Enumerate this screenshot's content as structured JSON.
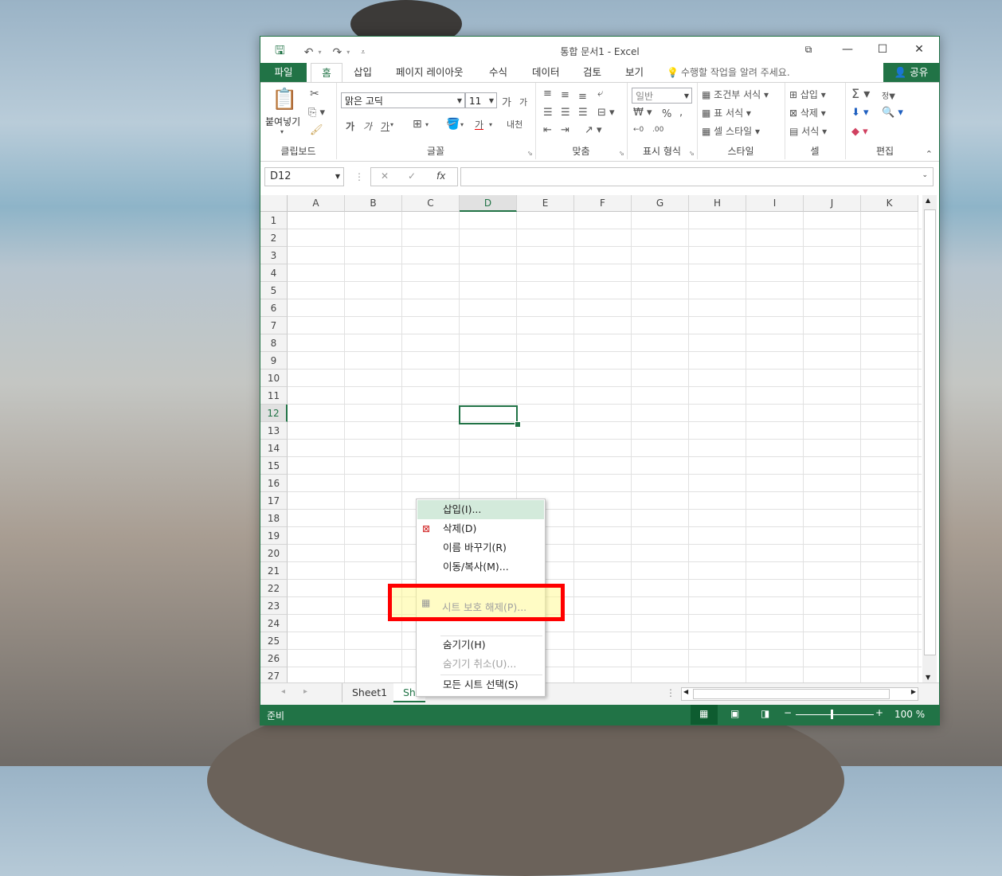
{
  "window": {
    "title": "통합 문서1 - Excel"
  },
  "tabs": {
    "file": "파일",
    "home": "홈",
    "insert": "삽입",
    "layout": "페이지 레이아웃",
    "formulas": "수식",
    "data": "데이터",
    "review": "검토",
    "view": "보기",
    "tell_me": "수행할 작업을 알려 주세요.",
    "share": "공유"
  },
  "ribbon": {
    "paste": "붙여넣기",
    "clipboard": "클립보드",
    "font_name": "맑은 고딕",
    "font_size": "11",
    "font": "글꼴",
    "align": "맞춤",
    "number_format": "일반",
    "number": "표시 형식",
    "cond_format": "조건부 서식",
    "table_format": "표 서식",
    "cell_style": "셀 스타일",
    "styles": "스타일",
    "insert": "삽입",
    "delete": "삭제",
    "format": "서식",
    "cells": "셀",
    "editing": "편집",
    "bold": "가",
    "italic": "가",
    "underline": "가",
    "grow_font": "가",
    "shrink_font": "가",
    "font_color": "가",
    "phonetic": "내천",
    "percent": "%",
    "comma": ",",
    "dec_inc": "←0",
    "dec_dec": ".00",
    "sort_filter": "정▼"
  },
  "formula": {
    "namebox": "D12",
    "cancel": "✕",
    "enter": "✓",
    "fx": "fx",
    "value": ""
  },
  "grid": {
    "columns": [
      "A",
      "B",
      "C",
      "D",
      "E",
      "F",
      "G",
      "H",
      "I",
      "J",
      "K"
    ],
    "rows": [
      "1",
      "2",
      "3",
      "4",
      "5",
      "6",
      "7",
      "8",
      "9",
      "10",
      "11",
      "12",
      "13",
      "14",
      "15",
      "16",
      "17",
      "18",
      "19",
      "20",
      "21",
      "22",
      "23",
      "24",
      "25",
      "26",
      "27"
    ],
    "selected_col": "D",
    "selected_row": "12"
  },
  "sheets": {
    "tab1": "Sheet1",
    "tab2": "Sh"
  },
  "status": {
    "ready": "준비",
    "zoom": "100 %"
  },
  "context_menu": {
    "insert": "삽입(I)...",
    "delete": "삭제(D)",
    "rename": "이름 바꾸기(R)",
    "move_copy": "이동/복사(M)...",
    "unprotect": "시트 보호 해제(P)...",
    "hide": "숨기기(H)",
    "unhide": "숨기기 취소(U)...",
    "select_all": "모든 시트 선택(S)"
  }
}
